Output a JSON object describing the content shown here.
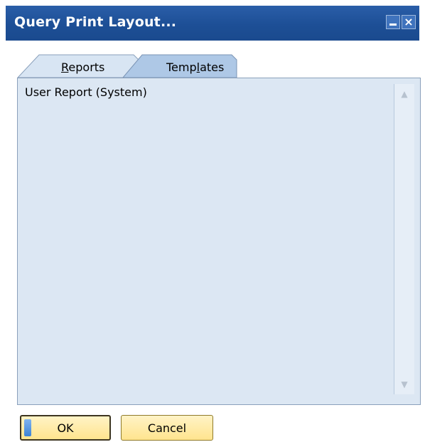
{
  "window": {
    "title": "Query Print Layout..."
  },
  "tabs": [
    {
      "label_before": "",
      "label_mnemonic": "R",
      "label_after": "eports",
      "selected": false
    },
    {
      "label_before": "Temp",
      "label_mnemonic": "l",
      "label_after": "ates",
      "selected": true
    }
  ],
  "list": {
    "items": [
      "User Report (System)"
    ]
  },
  "buttons": {
    "ok_label": "OK",
    "cancel_label": "Cancel"
  },
  "colors": {
    "titlebar": "#1d4f96",
    "list_background": "#dce7f3",
    "button_fill": "#ffe48e",
    "tab_selected": "#aec8e6",
    "tab_unselected": "#d8e5f3"
  },
  "icons": {
    "minimize": "minimize-icon",
    "close": "close-icon",
    "scroll_up": "chevron-up-icon",
    "scroll_down": "chevron-down-icon"
  }
}
